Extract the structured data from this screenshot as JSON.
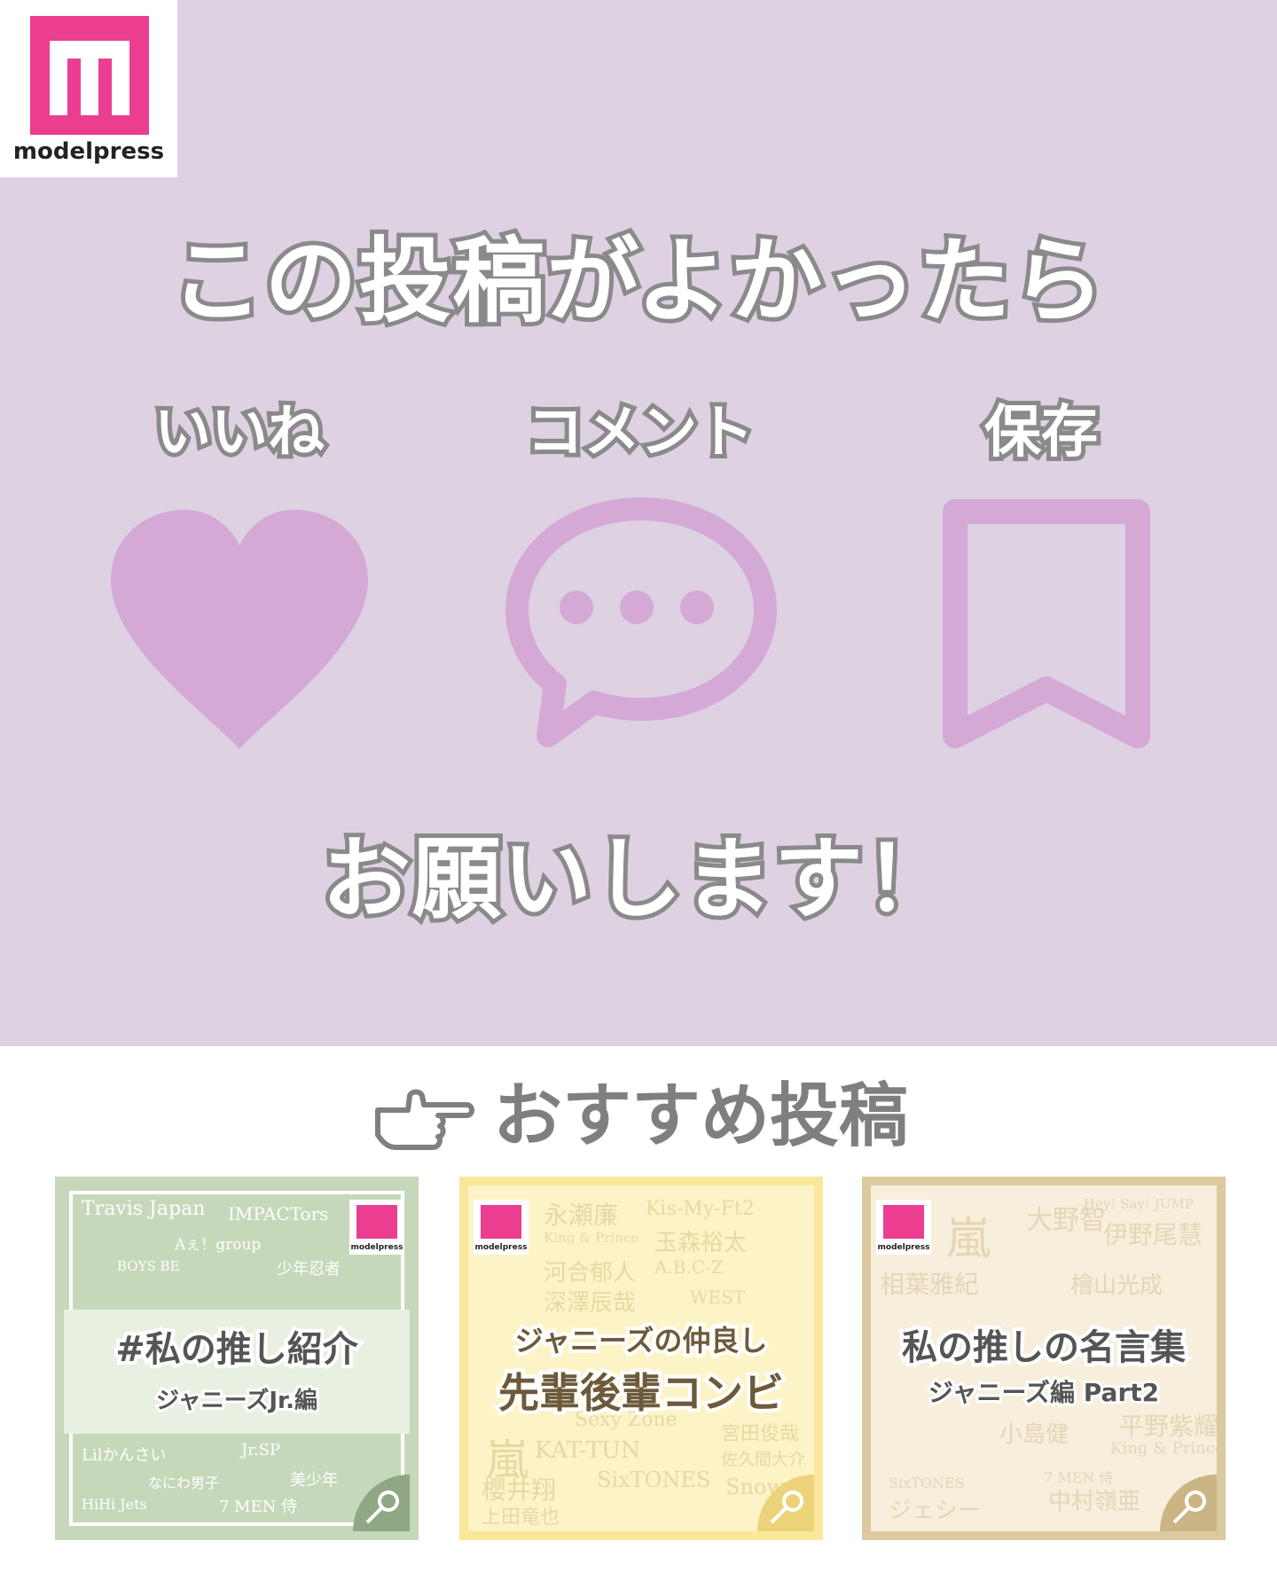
{
  "brand": {
    "name": "modelpress"
  },
  "headline": "この投稿がよかったら",
  "actions": [
    {
      "label": "いいね",
      "icon": "heart-icon"
    },
    {
      "label": "コメント",
      "icon": "speech-bubble-icon"
    },
    {
      "label": "保存",
      "icon": "bookmark-icon"
    }
  ],
  "closing": "お願いします！",
  "recommended": {
    "title": "おすすめ投稿",
    "icon": "pointing-hand-icon",
    "cards": [
      {
        "title": "#私の推し紹介",
        "subtitle": "ジャニーズJr.編",
        "bg_words": [
          "Travis Japan",
          "IMPACTors",
          "Aぇ！group",
          "BOYS BE",
          "少年忍者",
          "Lilかんさい",
          "Jr.SP",
          "なにわ男子",
          "美少年",
          "HiHi Jets",
          "7 MEN 侍"
        ]
      },
      {
        "title": "ジャニーズの仲良し",
        "subtitle": "先輩後輩コンビ",
        "bg_words": [
          "永瀬廉",
          "Kis-My-Ft2",
          "King & Prince",
          "玉森裕太",
          "河合郁人",
          "A.B.C-Z",
          "深澤辰哉",
          "WEST",
          "Sexy Zone",
          "嵐",
          "KAT-TUN",
          "櫻井翔",
          "上田竜也",
          "SixTONES",
          "Snow Man",
          "宮田俊哉",
          "佐久間大介"
        ]
      },
      {
        "title": "私の推しの名言集",
        "subtitle": "ジャニーズ編 Part2",
        "bg_words": [
          "嵐",
          "大野智",
          "Hey! Say! JUMP",
          "伊野尾慧",
          "相葉雅紀",
          "檜山光成",
          "平野紫耀",
          "King & Prince",
          "7 MEN 侍",
          "中村嶺亜",
          "SixTONES",
          "ジェシー",
          "小島健"
        ]
      }
    ]
  },
  "colors": {
    "top_bg": "#ded1e2",
    "icon": "#d4a9d6",
    "brand": "#ec3e91",
    "outline": "#8a8a8a"
  }
}
